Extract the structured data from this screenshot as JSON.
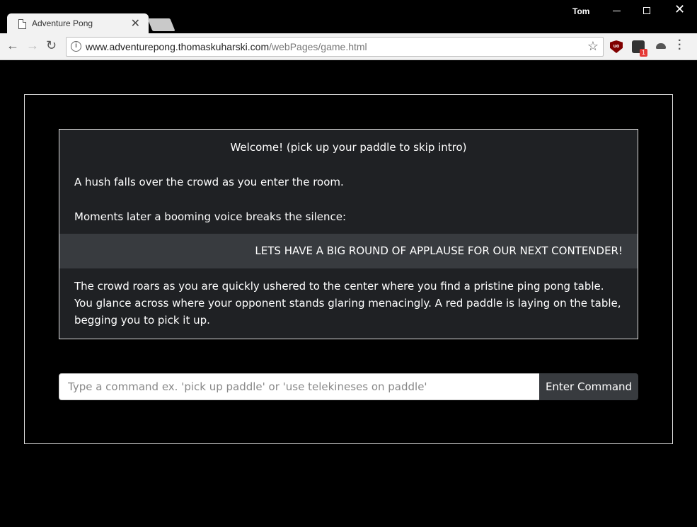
{
  "browser": {
    "tab_title": "Adventure Pong",
    "tab_close": "✕",
    "user_name": "Tom",
    "url_host": "www.adventurepong.thomaskuharski.com",
    "url_path": "/webPages/game.html",
    "ublock_label": "uo",
    "ext_badge": "1"
  },
  "story": {
    "welcome": "Welcome! (pick up your paddle to skip intro)",
    "hush": "A hush falls over the crowd as you enter the room.",
    "moments": "Moments later a booming voice breaks the silence:",
    "applause": "LETS HAVE A BIG ROUND OF APPLAUSE FOR OUR NEXT CONTENDER!",
    "crowd": "The crowd roars as you are quickly ushered to the center where you find a pristine ping pong table. You glance across where your opponent stands glaring menacingly. A red paddle is laying on the table, begging you to pick it up."
  },
  "command": {
    "placeholder": "Type a command ex. 'pick up paddle' or 'use telekineses on paddle'",
    "value": "",
    "button_label": "Enter Command"
  }
}
